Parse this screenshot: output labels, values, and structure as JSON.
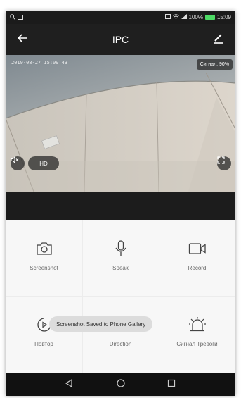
{
  "status_bar": {
    "battery": "100%",
    "time": "15:09"
  },
  "header": {
    "title": "IPC"
  },
  "video": {
    "timestamp": "2019-08-27 15:09:43",
    "signal": "Сигнал: 90%",
    "hd_label": "HD"
  },
  "controls": {
    "row1": [
      {
        "label": "Screenshot",
        "icon": "camera-icon"
      },
      {
        "label": "Speak",
        "icon": "microphone-icon"
      },
      {
        "label": "Record",
        "icon": "video-camera-icon"
      }
    ],
    "row2": [
      {
        "label": "Повтор",
        "icon": "playback-icon"
      },
      {
        "label": "Direction",
        "icon": "direction-icon"
      },
      {
        "label": "Сигнал Тревоги",
        "icon": "alarm-icon"
      }
    ]
  },
  "toast": "Screenshot Saved to Phone Gallery",
  "colors": {
    "header": "#1f1f1f",
    "controls_bg": "#f7f7f7",
    "battery": "#4cd964"
  }
}
